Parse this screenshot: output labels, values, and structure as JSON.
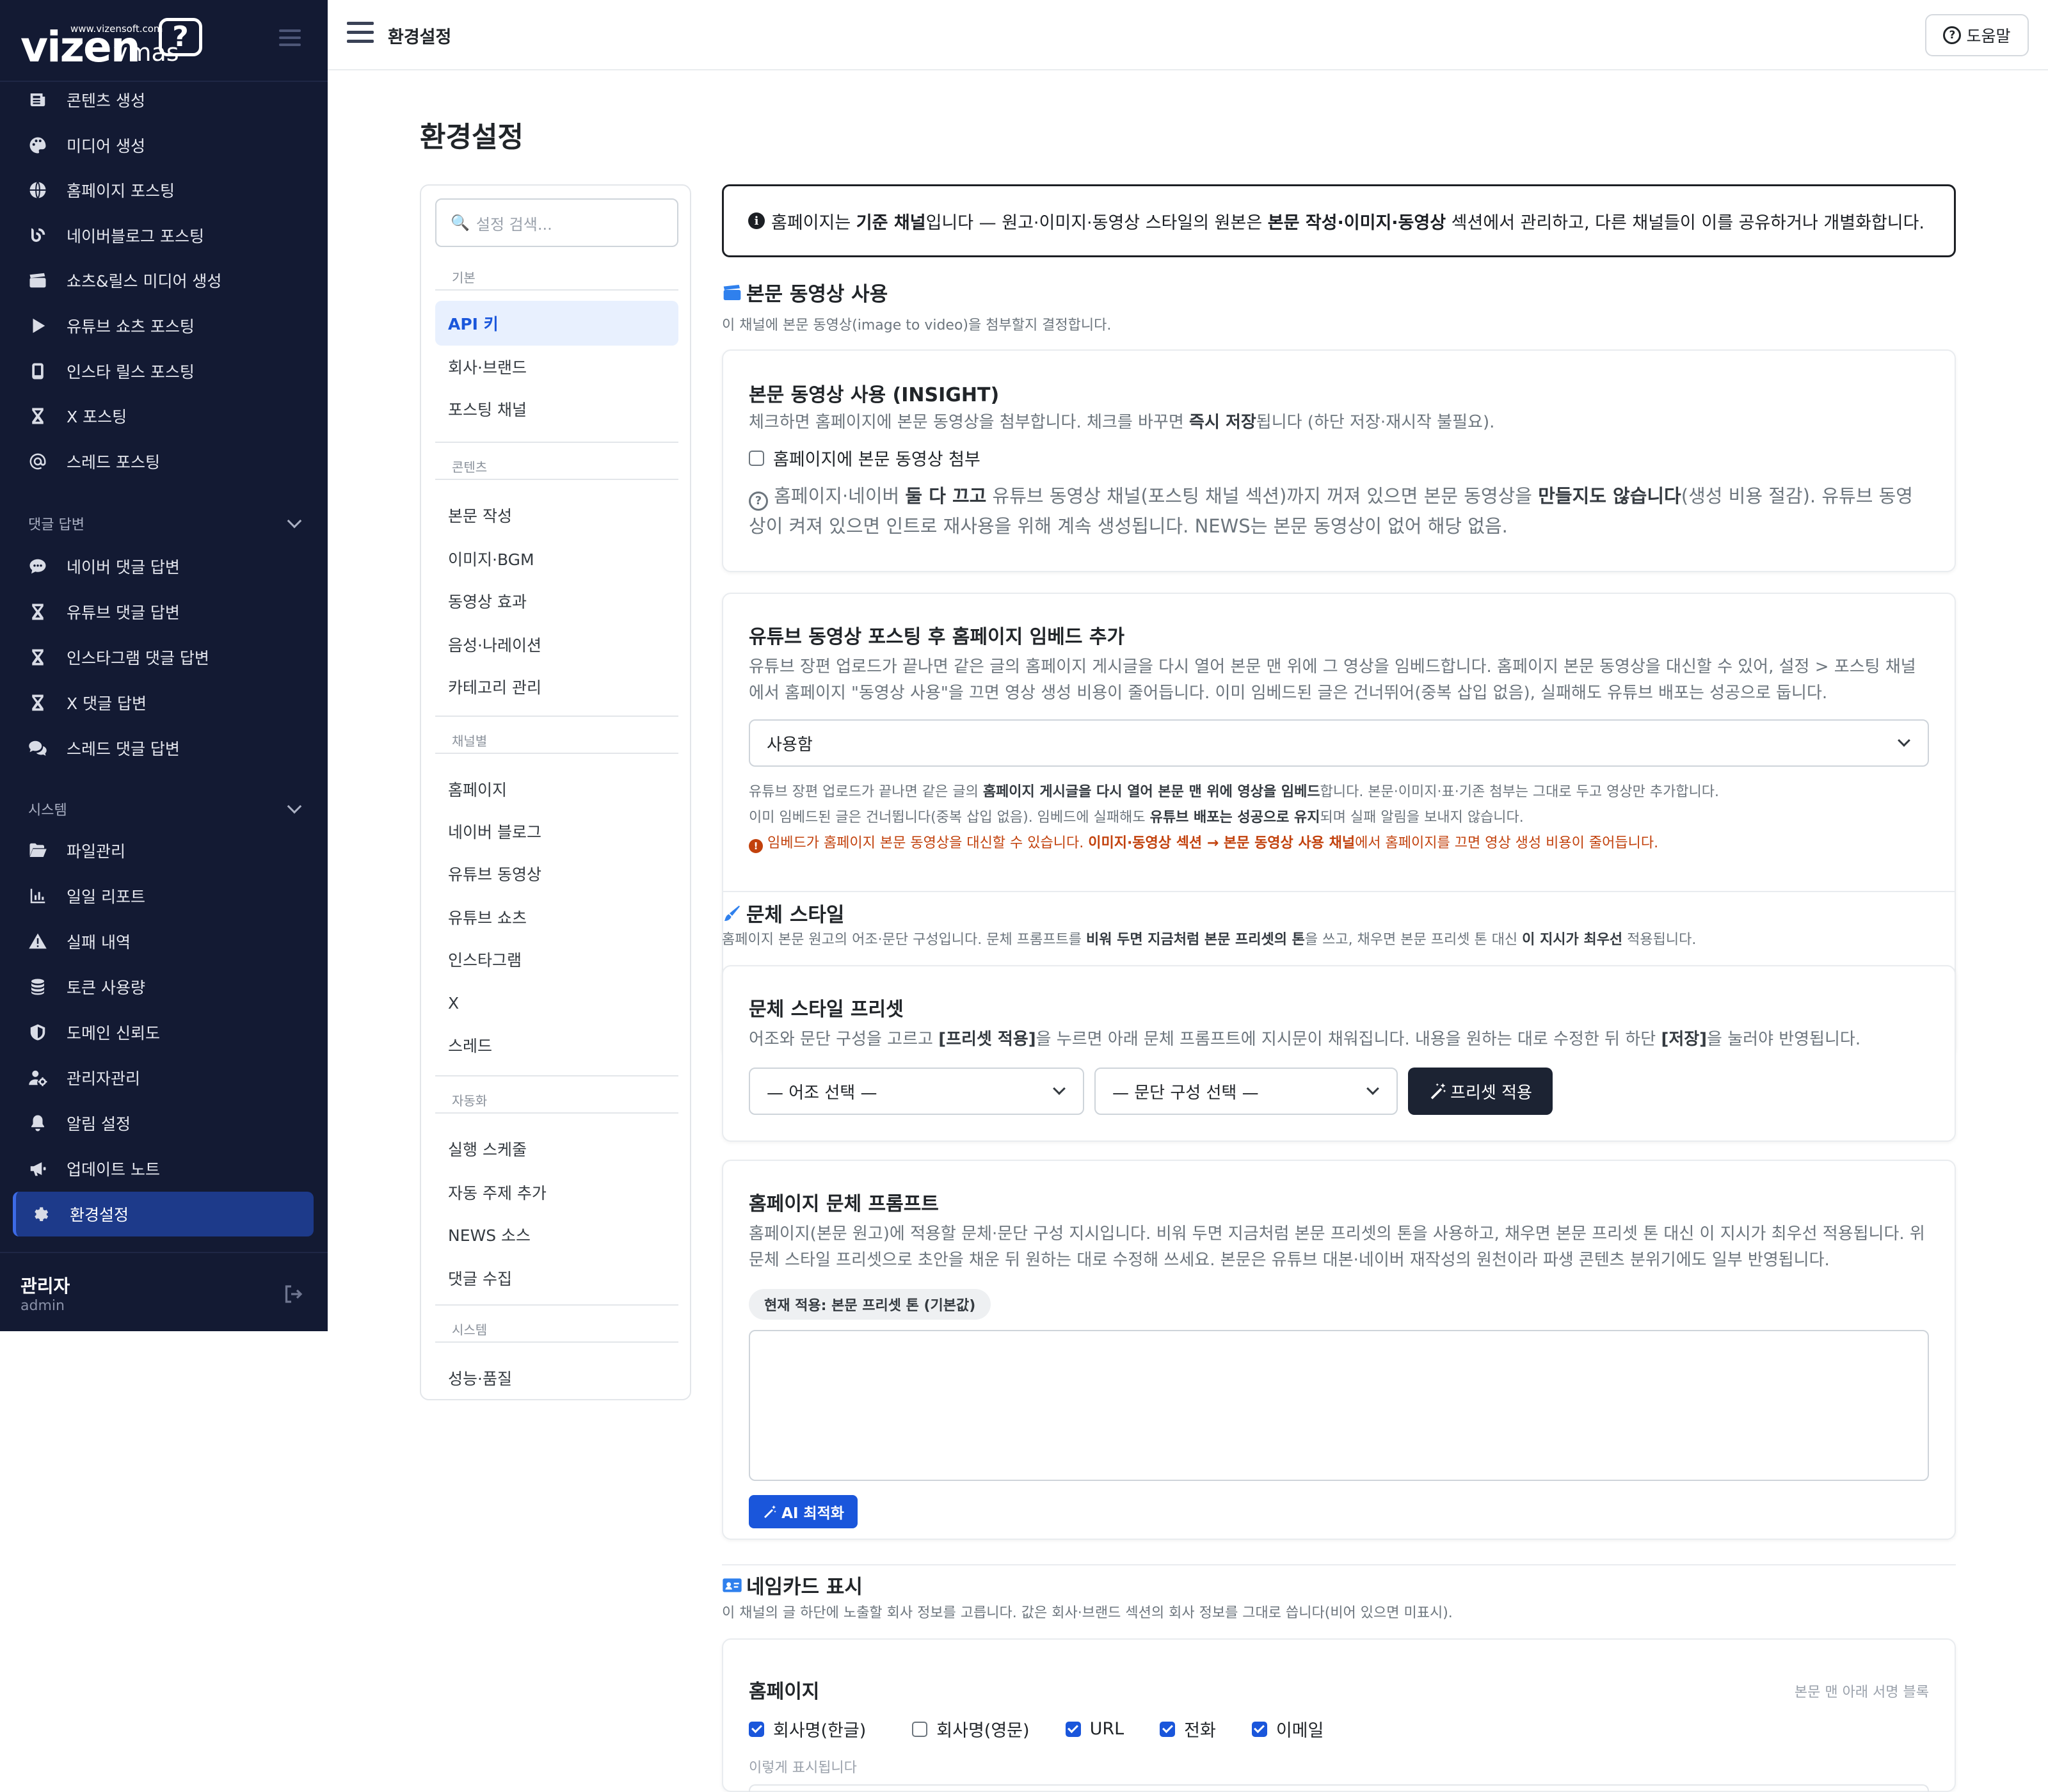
{
  "sidebar": {
    "logo_brand": "vizen",
    "logo_sub": "vmas",
    "logo_url": "www.vizensoft.com",
    "logo_mark": "?",
    "items": [
      {
        "label": "콘텐츠 생성",
        "icon": "newspaper-icon"
      },
      {
        "label": "미디어 생성",
        "icon": "palette-icon"
      },
      {
        "label": "홈페이지 포스팅",
        "icon": "globe-icon"
      },
      {
        "label": "네이버블로그 포스팅",
        "icon": "blog-icon"
      },
      {
        "label": "쇼츠&릴스 미디어 생성",
        "icon": "clapperboard-icon"
      },
      {
        "label": "유튜브 쇼츠 포스팅",
        "icon": "play-icon"
      },
      {
        "label": "인스타 릴스 포스팅",
        "icon": "phone-icon"
      },
      {
        "label": "X 포스팅",
        "icon": "hourglass-icon"
      },
      {
        "label": "스레드 포스팅",
        "icon": "at-icon"
      }
    ],
    "group_reply": "댓글 답변",
    "reply_items": [
      {
        "label": "네이버 댓글 답변",
        "icon": "comment-dots-icon"
      },
      {
        "label": "유튜브 댓글 답변",
        "icon": "hourglass-icon"
      },
      {
        "label": "인스타그램 댓글 답변",
        "icon": "hourglass-icon"
      },
      {
        "label": "X 댓글 답변",
        "icon": "hourglass-icon"
      },
      {
        "label": "스레드 댓글 답변",
        "icon": "comments-icon"
      }
    ],
    "group_system": "시스템",
    "system_items": [
      {
        "label": "파일관리",
        "icon": "folder-open-icon"
      },
      {
        "label": "일일 리포트",
        "icon": "chart-line-icon"
      },
      {
        "label": "실패 내역",
        "icon": "warning-icon"
      },
      {
        "label": "토큰 사용량",
        "icon": "coins-icon"
      },
      {
        "label": "도메인 신뢰도",
        "icon": "shield-icon"
      },
      {
        "label": "관리자관리",
        "icon": "user-gear-icon"
      },
      {
        "label": "알림 설정",
        "icon": "bell-icon"
      },
      {
        "label": "업데이트 노트",
        "icon": "megaphone-icon"
      },
      {
        "label": "환경설정",
        "icon": "gear-icon"
      }
    ],
    "user_name": "관리자",
    "user_role": "admin"
  },
  "topbar": {
    "title": "환경설정",
    "help_label": "도움말"
  },
  "page_title": "환경설정",
  "settings_nav": {
    "search_placeholder": "설정 검색...",
    "sections": [
      {
        "title": "기본",
        "items": [
          "API 키",
          "회사·브랜드",
          "포스팅 채널"
        ]
      },
      {
        "title": "콘텐츠",
        "items": [
          "본문 작성",
          "이미지·BGM",
          "동영상 효과",
          "음성·나레이션",
          "카테고리 관리"
        ]
      },
      {
        "title": "채널별",
        "items": [
          "홈페이지",
          "네이버 블로그",
          "유튜브 동영상",
          "유튜브 쇼츠",
          "인스타그램",
          "X",
          "스레드"
        ]
      },
      {
        "title": "자동화",
        "items": [
          "실행 스케줄",
          "자동 주제 추가",
          "NEWS 소스",
          "댓글 수집"
        ]
      },
      {
        "title": "시스템",
        "items": [
          "성능·품질"
        ]
      }
    ],
    "active_item": "API 키"
  },
  "notice": {
    "t1": "홈페이지는 ",
    "b1": "기준 채널",
    "t2": "입니다 — 원고·이미지·동영상 스타일의 원본은 ",
    "b2": "본문 작성·이미지·동영상",
    "t3": " 섹션에서 관리하고, 다른 채널들이 이를 공유하거나 개별화합니다."
  },
  "section_video": {
    "title": "본문 동영상 사용",
    "desc": "이 채널에 본문 동영상(image to video)을 첨부할지 결정합니다.",
    "card1": {
      "title": "본문 동영상 사용 (INSIGHT)",
      "d1": "체크하면 홈페이지에 본문 동영상을 첨부합니다. 체크를 바꾸면 ",
      "d1b": "즉시 저장",
      "d1c": "됩니다 (하단 저장·재시작 불필요).",
      "checkbox_label": "홈페이지에 본문 동영상 첨부",
      "checked": false,
      "h1": " 홈페이지·네이버 ",
      "h1b": "둘 다 끄고",
      "h2": " 유튜브 동영상 채널(포스팅 채널 섹션)까지 꺼져 있으면 본문 동영상을 ",
      "h2b": "만들지도 않습니다",
      "h3": "(생성 비용 절감). 유튜브 동영상이 켜져 있으면 인트로 재사용을 위해 계속 생성됩니다. NEWS는 본문 동영상이 없어 해당 없음."
    },
    "card2": {
      "title": "유튜브 동영상 포스팅 후 홈페이지 임베드 추가",
      "desc": "유튜브 장편 업로드가 끝나면 같은 글의 홈페이지 게시글을 다시 열어 본문 맨 위에 그 영상을 임베드합니다. 홈페이지 본문 동영상을 대신할 수 있어, 설정 > 포스팅 채널에서 홈페이지 \"동영상 사용\"을 끄면 영상 생성 비용이 줄어듭니다. 이미 임베드된 글은 건너뛰어(중복 삽입 없음), 실패해도 유튜브 배포는 성공으로 둡니다.",
      "select_value": "사용함",
      "n1a": "유튜브 장편 업로드가 끝나면 같은 글의 ",
      "n1b": "홈페이지 게시글을 다시 열어 본문 맨 위에 영상을 임베드",
      "n1c": "합니다. 본문·이미지·표·기존 첨부는 그대로 두고 영상만 추가합니다.",
      "n2a": "이미 임베드된 글은 건너뜁니다(중복 삽입 없음). 임베드에 실패해도 ",
      "n2b": "유튜브 배포는 성공으로 유지",
      "n2c": "되며 실패 알림을 보내지 않습니다.",
      "w1": " 임베드가 홈페이지 본문 동영상을 대신할 수 있습니다. ",
      "w2": "이미지·동영상 섹션 → 본문 동영상 사용 채널",
      "w3": "에서 홈페이지를 끄면 영상 생성 비용이 줄어듭니다."
    }
  },
  "section_style": {
    "title": "문체 스타일",
    "d1": "홈페이지 본문 원고의 어조·문단 구성입니다. 문체 프롬프트를 ",
    "d1b": "비워 두면 지금처럼 본문 프리셋의 톤",
    "d2": "을 쓰고, 채우면 본문 프리셋 톤 대신 ",
    "d2b": "이 지시가 최우선",
    "d3": " 적용됩니다.",
    "preset_card": {
      "title": "문체 스타일 프리셋",
      "d1": "어조와 문단 구성을 고르고 ",
      "d1b": "[프리셋 적용]",
      "d2": "을 누르면 아래 문체 프롬프트에 지시문이 채워집니다. 내용을 원하는 대로 수정한 뒤 하단 ",
      "d2b": "[저장]",
      "d3": "을 눌러야 반영됩니다.",
      "tone_select": "— 어조 선택 —",
      "para_select": "— 문단 구성 선택 —",
      "apply_label": "프리셋 적용"
    },
    "prompt_card": {
      "title": "홈페이지 문체 프롬프트",
      "desc": "홈페이지(본문 원고)에 적용할 문체·문단 구성 지시입니다. 비워 두면 지금처럼 본문 프리셋의 톤을 사용하고, 채우면 본문 프리셋 톤 대신 이 지시가 최우선 적용됩니다. 위 문체 스타일 프리셋으로 초안을 채운 뒤 원하는 대로 수정해 쓰세요. 본문은 유튜브 대본·네이버 재작성의 원천이라 파생 콘텐츠 분위기에도 일부 반영됩니다.",
      "badge": "현재 적용: 본문 프리셋 톤 (기본값)",
      "textarea_value": "",
      "ai_label": "AI 최적화"
    }
  },
  "section_namecard": {
    "title": "네임카드 표시",
    "desc": "이 채널의 글 하단에 노출할 회사 정보를 고릅니다. 값은 회사·브랜드 섹션의 회사 정보를 그대로 씁니다(비어 있으면 미표시).",
    "card": {
      "title": "홈페이지",
      "hint": "본문 맨 아래 서명 블록",
      "checks": [
        {
          "label": "회사명(한글)",
          "checked": true
        },
        {
          "label": "회사명(영문)",
          "checked": false
        },
        {
          "label": "URL",
          "checked": true
        },
        {
          "label": "전화",
          "checked": true
        },
        {
          "label": "이메일",
          "checked": true
        }
      ],
      "preview_label": "이렇게 표시됩니다"
    }
  },
  "colors": {
    "sidebar_bg": "#131a33",
    "accent": "#1a56db",
    "warning": "#c2410c"
  }
}
